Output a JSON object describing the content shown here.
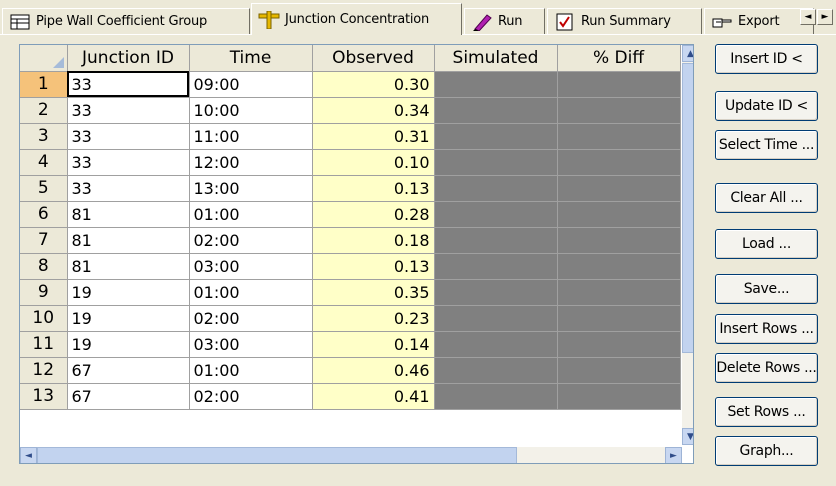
{
  "tabs": [
    {
      "label": "Pipe Wall Coefficient Group",
      "icon": "database-icon",
      "active": false
    },
    {
      "label": "Junction Concentration",
      "icon": "junction-icon",
      "active": true
    },
    {
      "label": "Run",
      "icon": "pencil-icon",
      "active": false
    },
    {
      "label": "Run Summary",
      "icon": "checklist-icon",
      "active": false
    },
    {
      "label": "Export",
      "icon": "pointing-hand-icon",
      "active": false
    }
  ],
  "tab_nav": {
    "left": "◄",
    "right": "►"
  },
  "grid": {
    "columns": [
      "Junction ID",
      "Time",
      "Observed",
      "Simulated",
      "% Diff"
    ],
    "rows": [
      {
        "n": "1",
        "id": "33",
        "time": "09:00",
        "observed": "0.30"
      },
      {
        "n": "2",
        "id": "33",
        "time": "10:00",
        "observed": "0.34"
      },
      {
        "n": "3",
        "id": "33",
        "time": "11:00",
        "observed": "0.31"
      },
      {
        "n": "4",
        "id": "33",
        "time": "12:00",
        "observed": "0.10"
      },
      {
        "n": "5",
        "id": "33",
        "time": "13:00",
        "observed": "0.13"
      },
      {
        "n": "6",
        "id": "81",
        "time": "01:00",
        "observed": "0.28"
      },
      {
        "n": "7",
        "id": "81",
        "time": "02:00",
        "observed": "0.18"
      },
      {
        "n": "8",
        "id": "81",
        "time": "03:00",
        "observed": "0.13"
      },
      {
        "n": "9",
        "id": "19",
        "time": "01:00",
        "observed": "0.35"
      },
      {
        "n": "10",
        "id": "19",
        "time": "02:00",
        "observed": "0.23"
      },
      {
        "n": "11",
        "id": "19",
        "time": "03:00",
        "observed": "0.14"
      },
      {
        "n": "12",
        "id": "67",
        "time": "01:00",
        "observed": "0.46"
      },
      {
        "n": "13",
        "id": "67",
        "time": "02:00",
        "observed": "0.41"
      }
    ]
  },
  "buttons": {
    "insert_id": "Insert ID <",
    "update_id": "Update ID <",
    "select_time": "Select Time ...",
    "clear_all": "Clear All ...",
    "load": "Load ...",
    "save": "Save...",
    "insert_rows": "Insert Rows ...",
    "delete_rows": "Delete Rows ...",
    "set_rows": "Set Rows ...",
    "graph": "Graph..."
  },
  "scroll": {
    "up": "▲",
    "down": "▼",
    "left": "◄",
    "right": "►"
  }
}
